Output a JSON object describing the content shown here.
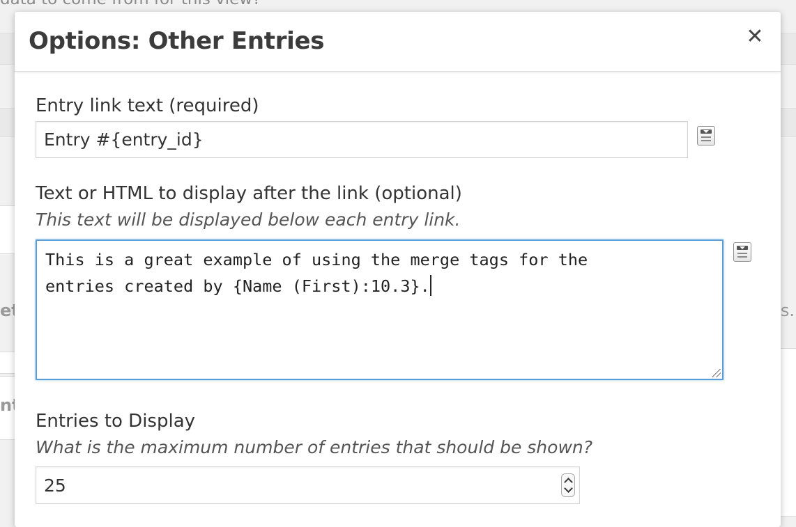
{
  "background": {
    "top_text": "data to come from for this view?",
    "frag_left_1": "et",
    "frag_left_2": "nt",
    "frag_right": "s."
  },
  "modal": {
    "title": "Options: Other Entries",
    "close_symbol": "✕"
  },
  "fields": {
    "link_text": {
      "label": "Entry link text (required)",
      "value": "Entry #{entry_id}"
    },
    "after_link": {
      "label": "Text or HTML to display after the link (optional)",
      "hint": "This text will be displayed below each entry link.",
      "value": "This is a great example of using the merge tags for the\nentries created by {Name (First):10.3}."
    },
    "entries_to_display": {
      "label": "Entries to Display",
      "hint": "What is the maximum number of entries that should be shown?",
      "value": "25"
    }
  },
  "icons": {
    "merge_tags": "merge-tags-icon",
    "close": "close-icon",
    "resize": "resize-grip-icon",
    "spinner": "number-spinner-icon"
  }
}
